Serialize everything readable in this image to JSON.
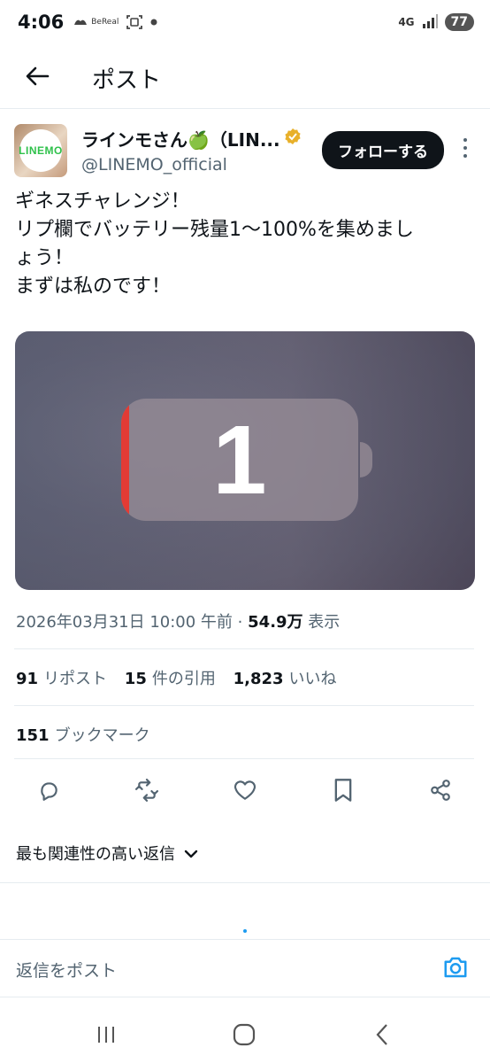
{
  "status_bar": {
    "time": "4:06",
    "bereal_label": "BeReal",
    "network": "4G",
    "battery": "77"
  },
  "header": {
    "title": "ポスト"
  },
  "author": {
    "name": "ラインモさん🍏（LIN...",
    "handle": "@LINEMO_official",
    "avatar_text": "LINEMO",
    "follow_label": "フォローする",
    "verified_color": "#e8b02a"
  },
  "tweet": {
    "lines": [
      "ギネスチャレンジ！",
      "リプ欄でバッテリー残量1〜100%を集めまし",
      "ょう！",
      "まずは私のです！"
    ]
  },
  "media": {
    "battery_number": "1",
    "battery_level": 0.01,
    "fill_color": "#e23b35"
  },
  "meta": {
    "datetime": "2026年03月31日 10:00 午前",
    "separator": "·",
    "views_count": "54.9万",
    "views_label": "表示"
  },
  "stats": {
    "reposts_count": "91",
    "reposts_label": "リポスト",
    "quotes_count": "15",
    "quotes_label": "件の引用",
    "likes_count": "1,823",
    "likes_label": "いいね",
    "bookmarks_count": "151",
    "bookmarks_label": "ブックマーク"
  },
  "replies": {
    "sort_label": "最も関連性の高い返信",
    "input_placeholder": "返信をポスト"
  },
  "colors": {
    "accent": "#1d9bf0",
    "text": "#0f1419",
    "muted": "#536471"
  }
}
